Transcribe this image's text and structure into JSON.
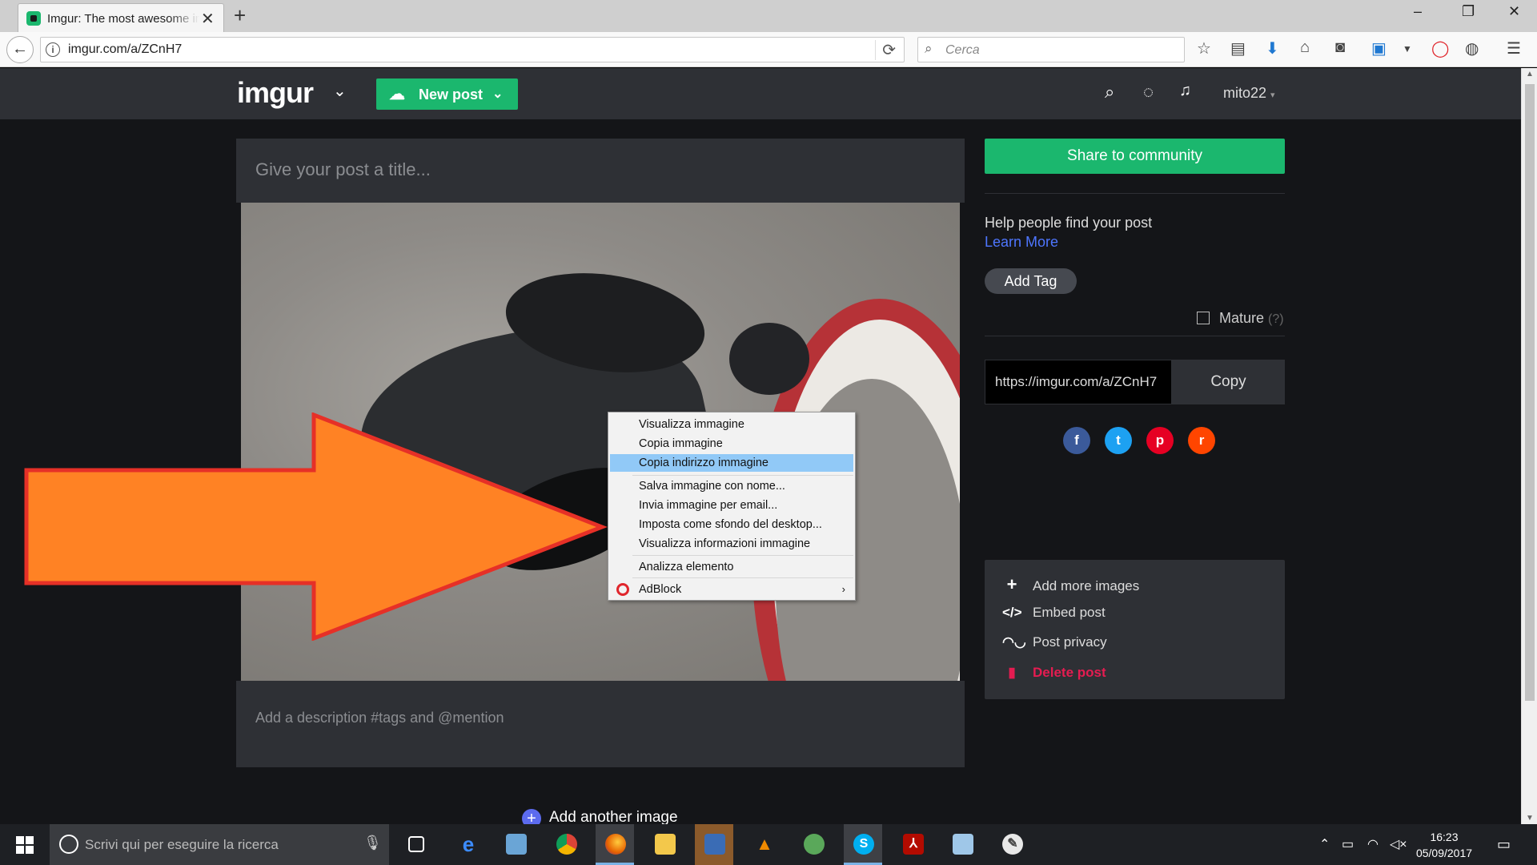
{
  "browser": {
    "tab_title": "Imgur: The most awesome images on the Internet",
    "url": "imgur.com/a/ZCnH7",
    "search_placeholder": "Cerca",
    "window_controls": {
      "minimize": "–",
      "maximize": "❐",
      "close": "✕"
    }
  },
  "imgur": {
    "logo": "imgur",
    "new_post_label": "New post",
    "username": "mito22",
    "title_placeholder": "Give your post a title...",
    "description_placeholder": "Add a description #tags and @mention",
    "add_another_label": "Add another image",
    "share_label": "Share to community",
    "help_text": "Help people find your post",
    "learn_more": "Learn More",
    "add_tag": "Add Tag",
    "mature_label": "Mature",
    "mature_help": "(?)",
    "share_link": "https://imgur.com/a/ZCnH7",
    "copy_label": "Copy",
    "social": [
      "f",
      "t",
      "p",
      "r"
    ],
    "tools": [
      {
        "icon": "plus-icon",
        "label": "Add more images"
      },
      {
        "icon": "code-icon",
        "label": "Embed post"
      },
      {
        "icon": "mask-icon",
        "label": "Post privacy"
      },
      {
        "icon": "trash-icon",
        "label": "Delete post"
      }
    ]
  },
  "context_menu": {
    "items": [
      {
        "label": "Visualizza immagine"
      },
      {
        "label": "Copia immagine"
      },
      {
        "label": "Copia indirizzo immagine",
        "highlighted": true
      },
      {
        "label": "Salva immagine con nome..."
      },
      {
        "label": "Invia immagine per email..."
      },
      {
        "label": "Imposta come sfondo del desktop..."
      },
      {
        "label": "Visualizza informazioni immagine"
      },
      {
        "label": "Analizza elemento"
      },
      {
        "label": "AdBlock",
        "submenu": true
      }
    ]
  },
  "taskbar": {
    "search_placeholder": "Scrivi qui per eseguire la ricerca",
    "time": "16:23",
    "date": "05/09/2017"
  },
  "colors": {
    "imgur_green": "#1bb76e",
    "link_blue": "#4e76ff",
    "danger": "#e51c51",
    "arrow_orange": "#ff8224",
    "arrow_border": "#e63027",
    "menu_highlight": "#91c9f7"
  }
}
